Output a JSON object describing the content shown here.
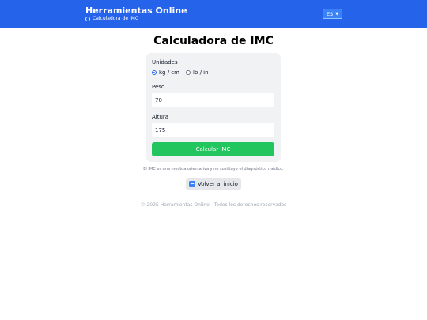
{
  "header": {
    "brand": "Herramientas Online",
    "subtitle": "Calculadora de IMC",
    "language": "ES"
  },
  "main": {
    "title": "Calculadora de IMC"
  },
  "form": {
    "units_label": "Unidades",
    "units_options": [
      "kg / cm",
      "lb / in"
    ],
    "units_selected": "kg / cm",
    "weight_label": "Peso",
    "weight_value": "70",
    "height_label": "Altura",
    "height_value": "175",
    "submit_label": "Calcular IMC"
  },
  "disclaimer": "El IMC es una medida orientativa y no sustituye el diagnóstico médico.",
  "back_label": "Volver al inicio",
  "footer": "© 2025 Herramientas Online - Todos los derechos reservados",
  "colors": {
    "header": "#2563eb",
    "submit": "#22c55e"
  }
}
